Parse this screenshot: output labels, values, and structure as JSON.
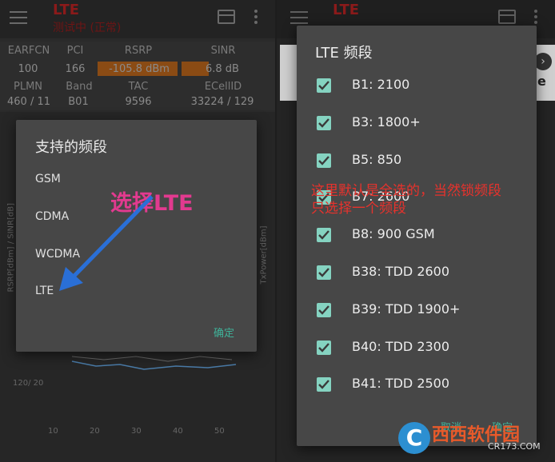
{
  "left_app": {
    "title": "LTE",
    "subtitle": "测试中 (正常)",
    "stats": {
      "headers1": [
        "EARFCN",
        "PCI",
        "RSRP",
        "SINR"
      ],
      "values1": [
        "100",
        "166",
        "-105.8 dBm",
        "6.8 dB"
      ],
      "headers2": [
        "PLMN",
        "Band",
        "TAC",
        "ECellID"
      ],
      "values2": [
        "460 / 11",
        "B01",
        "9596",
        "33224 / 129"
      ]
    },
    "chart": {
      "ylabel_left": "RSRP[dBm] / SINR[dB]",
      "ylabel_right": "TxPower[dBm]",
      "corner_label": "120/ 20",
      "xticks": [
        "10",
        "20",
        "30",
        "40",
        "50"
      ]
    }
  },
  "dialog1": {
    "title": "支持的频段",
    "options": [
      "GSM",
      "CDMA",
      "WCDMA",
      "LTE"
    ],
    "ok": "确定"
  },
  "annotation1": "选择LTE",
  "right_app": {
    "title": "LTE",
    "ad_letter": "e"
  },
  "dialog2": {
    "title": "LTE 频段",
    "bands": [
      {
        "label": "B1: 2100",
        "checked": true
      },
      {
        "label": "B3: 1800+",
        "checked": true
      },
      {
        "label": "B5: 850",
        "checked": true
      },
      {
        "label": "B7: 2600",
        "checked": true
      },
      {
        "label": "B8: 900 GSM",
        "checked": true
      },
      {
        "label": "B38: TDD 2600",
        "checked": true
      },
      {
        "label": "B39: TDD 1900+",
        "checked": true
      },
      {
        "label": "B40: TDD 2300",
        "checked": true
      },
      {
        "label": "B41: TDD 2500",
        "checked": true
      }
    ],
    "cancel": "取消",
    "ok": "确定"
  },
  "annotation2": {
    "line1": "这里默认是全选的，当然锁频段",
    "line2": "只选择一个频段"
  },
  "watermark": {
    "letter": "C",
    "text": "西西软件园",
    "url": "CR173.COM"
  },
  "colors": {
    "accent": "#3fb39a",
    "checkbox": "#85d3c1",
    "annotation_pink": "#e23a8f",
    "annotation_red": "#e8322c",
    "arrow_blue": "#2a6fd6"
  }
}
